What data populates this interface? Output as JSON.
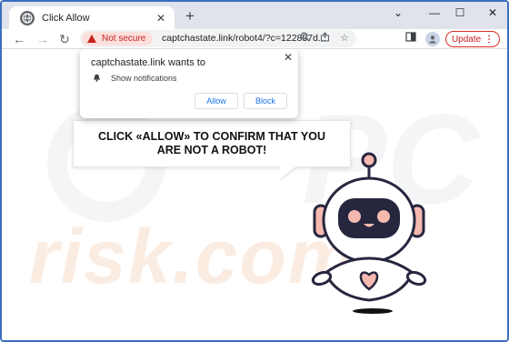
{
  "tab": {
    "title": "Click Allow",
    "close_icon": "close-icon"
  },
  "window_controls": {
    "chevron": "⌄",
    "minimize": "—",
    "maximize": "☐",
    "close": "✕"
  },
  "toolbar": {
    "security_label": "Not secure",
    "url": "captchastate.link/robot4/?c=122857d...",
    "update_label": "Update"
  },
  "popup": {
    "title": "captchastate.link wants to",
    "permission": "Show notifications",
    "allow_label": "Allow",
    "block_label": "Block"
  },
  "page": {
    "message": "CLICK «ALLOW» TO CONFIRM THAT YOU ARE NOT A ROBOT!",
    "watermark": "risk.com"
  },
  "colors": {
    "accent": "#1a73e8",
    "warning": "#c5221f",
    "robot_navy": "#26263f",
    "robot_pink": "#f5b9b0"
  }
}
